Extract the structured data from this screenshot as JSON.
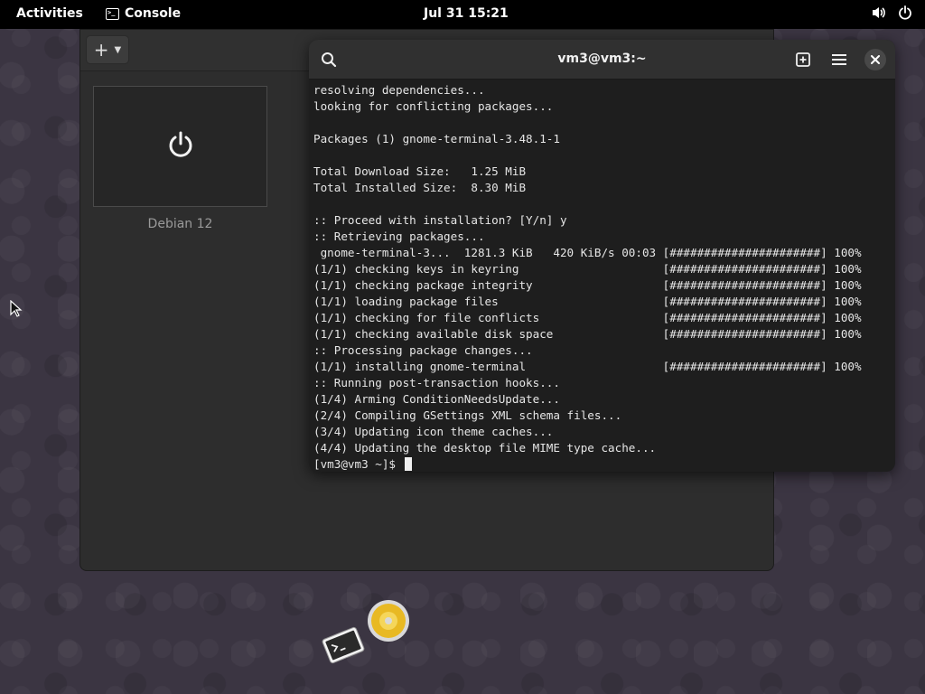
{
  "topbar": {
    "activities": "Activities",
    "app_name": "Console",
    "app_icon_glyph": ">_",
    "clock": "Jul 31  15:21",
    "volume_icon": "speaker-icon",
    "power_icon": "power-icon"
  },
  "boxes": {
    "new_button_label": "+",
    "vm_name": "Debian 12",
    "vm_icon": "power-icon"
  },
  "terminal": {
    "title": "vm3@vm3:~",
    "lines": [
      "resolving dependencies...",
      "looking for conflicting packages...",
      "",
      "Packages (1) gnome-terminal-3.48.1-1",
      "",
      "Total Download Size:   1.25 MiB",
      "Total Installed Size:  8.30 MiB",
      "",
      ":: Proceed with installation? [Y/n] y",
      ":: Retrieving packages...",
      " gnome-terminal-3...  1281.3 KiB   420 KiB/s 00:03 [######################] 100%",
      "(1/1) checking keys in keyring                     [######################] 100%",
      "(1/1) checking package integrity                   [######################] 100%",
      "(1/1) loading package files                        [######################] 100%",
      "(1/1) checking for file conflicts                  [######################] 100%",
      "(1/1) checking available disk space                [######################] 100%",
      ":: Processing package changes...",
      "(1/1) installing gnome-terminal                    [######################] 100%",
      ":: Running post-transaction hooks...",
      "(1/4) Arming ConditionNeedsUpdate...",
      "(2/4) Compiling GSettings XML schema files...",
      "(3/4) Updating icon theme caches...",
      "(4/4) Updating the desktop file MIME type cache..."
    ],
    "prompt": "[vm3@vm3 ~]$ "
  },
  "colors": {
    "topbar_bg": "#000000",
    "terminal_bg": "#1e1e1e",
    "header_bg": "#303030",
    "disc_accent": "#e8b923"
  }
}
